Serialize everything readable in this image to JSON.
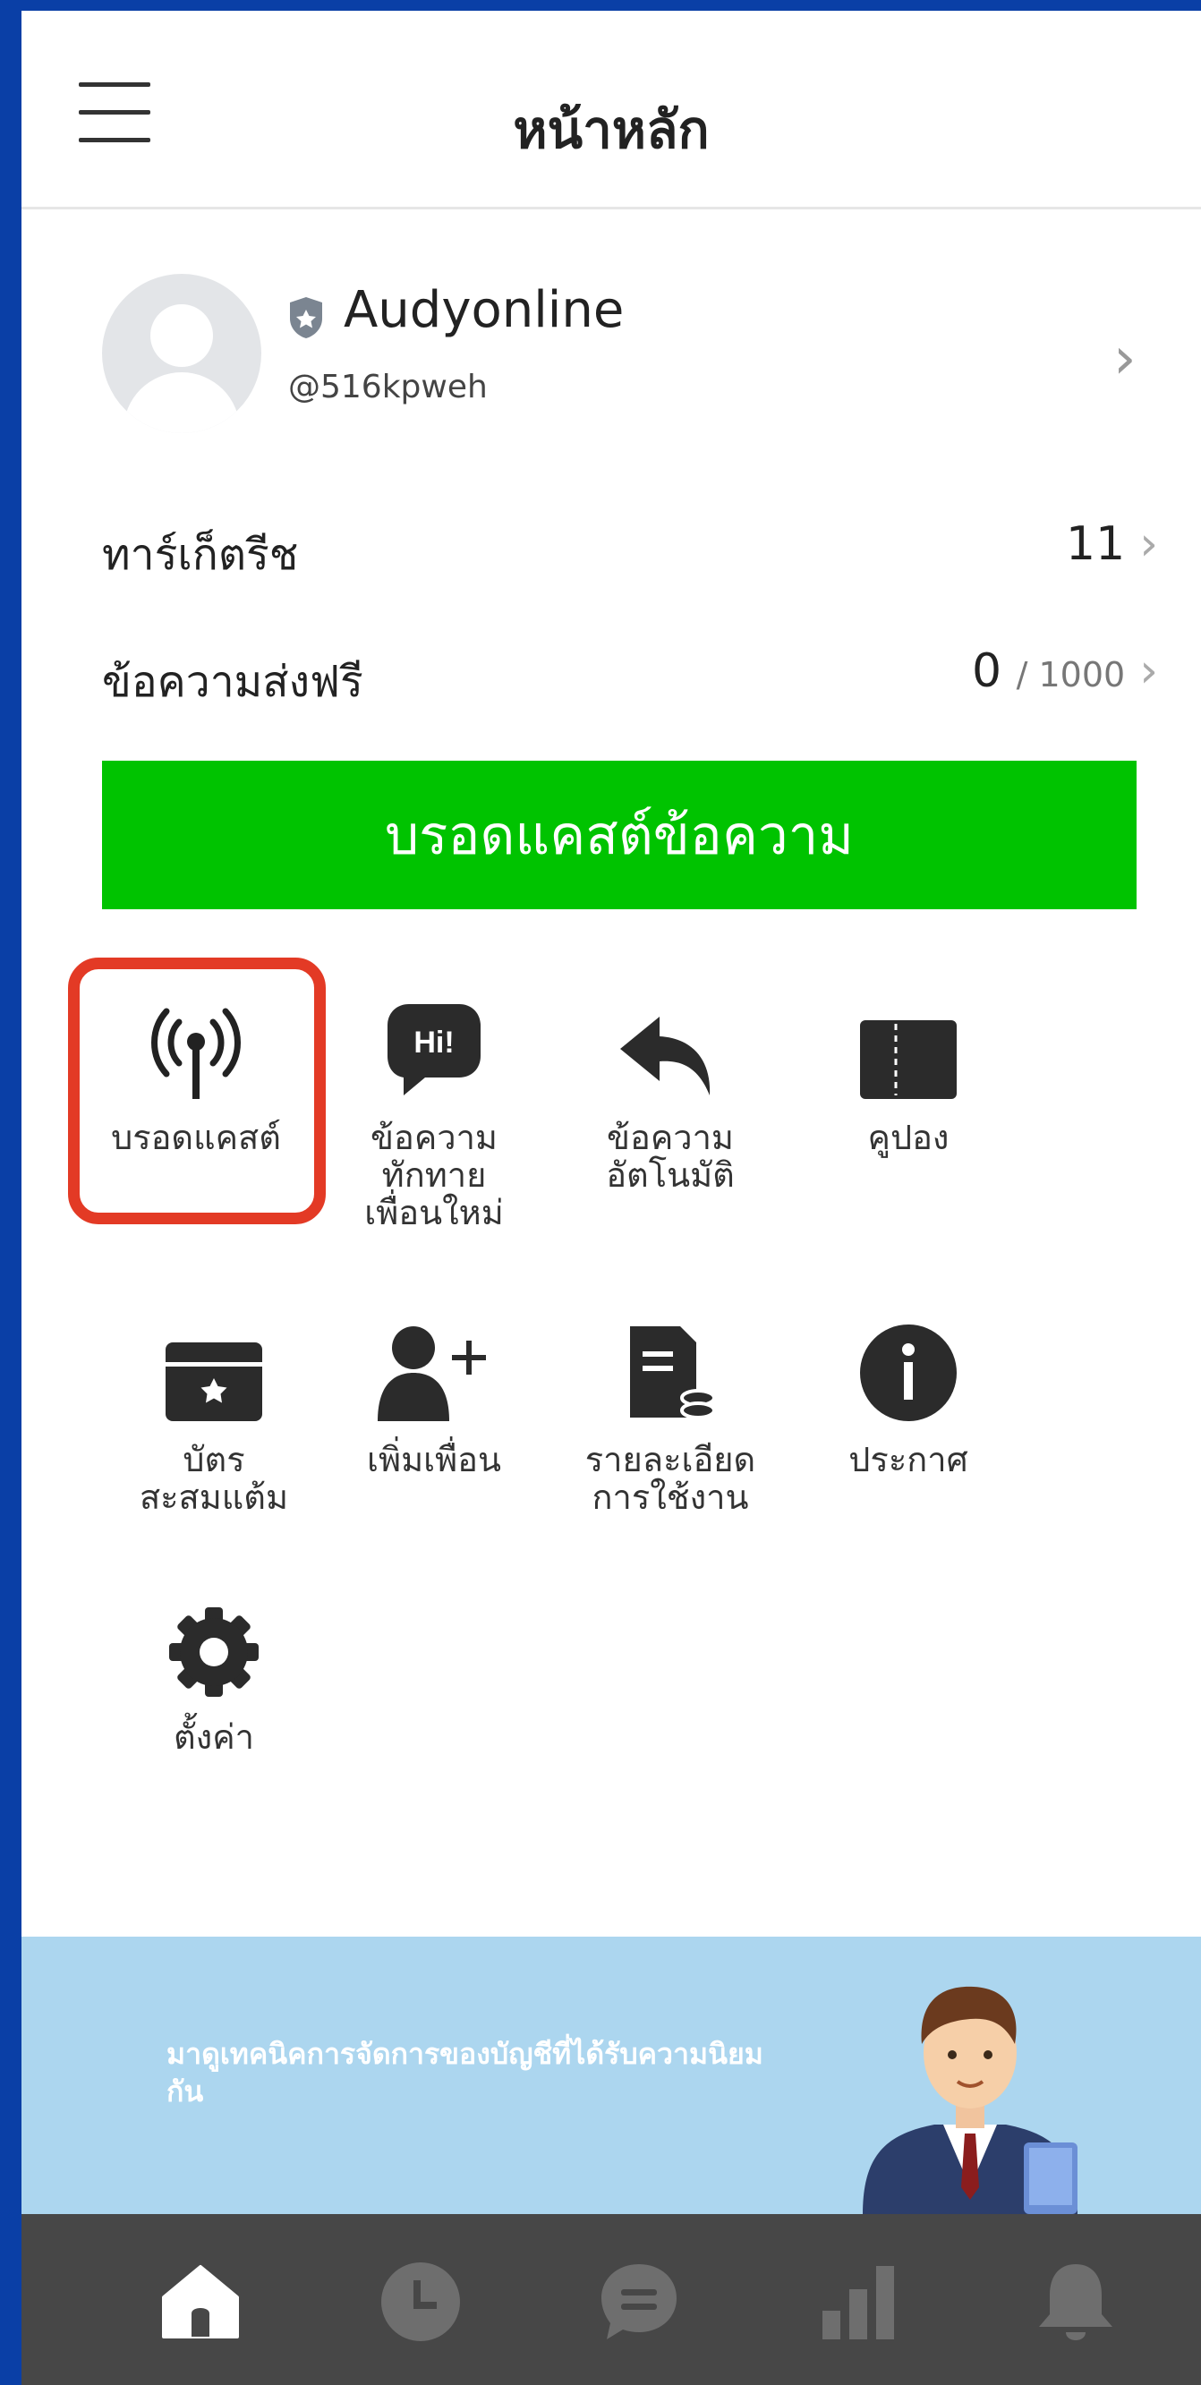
{
  "header": {
    "title": "หน้าหลัก"
  },
  "profile": {
    "name": "Audyonline",
    "id": "@516kpweh"
  },
  "stats": [
    {
      "label": "ทาร์เก็ตรีช",
      "value": "11"
    },
    {
      "label": "ข้อความส่งฟรี",
      "value": "0",
      "total": "/ 1000"
    }
  ],
  "broadcast_button": {
    "label": "บรอดแคสต์ข้อความ"
  },
  "features": [
    {
      "label": "บรอดแคสต์",
      "icon": "broadcast-icon",
      "highlighted": true
    },
    {
      "label": "ข้อความ\nทักทาย\nเพื่อนใหม่",
      "icon": "hi-bubble-icon"
    },
    {
      "label": "ข้อความ\nอัตโนมัติ",
      "icon": "reply-arrow-icon"
    },
    {
      "label": "คูปอง",
      "icon": "coupon-icon"
    },
    {
      "label": "บัตร\nสะสมแต้ม",
      "icon": "point-card-icon"
    },
    {
      "label": "เพิ่มเพื่อน",
      "icon": "add-friend-icon"
    },
    {
      "label": "รายละเอียด\nการใช้งาน",
      "icon": "usage-details-icon"
    },
    {
      "label": "ประกาศ",
      "icon": "info-icon"
    },
    {
      "label": "ตั้งค่า",
      "icon": "gear-icon"
    }
  ],
  "banner": {
    "text": "มาดูเทคนิคการจัดการของบัญชีที่ได้รับความนิยมกัน"
  },
  "bottom_nav": [
    {
      "icon": "home-icon",
      "active": true
    },
    {
      "icon": "clock-icon"
    },
    {
      "icon": "chat-icon"
    },
    {
      "icon": "stats-icon"
    },
    {
      "icon": "bell-icon"
    }
  ],
  "colors": {
    "accent_green": "#00c300",
    "highlight_red": "#e33a25",
    "nav_bg": "#474747",
    "banner_bg": "#acd6ef"
  }
}
